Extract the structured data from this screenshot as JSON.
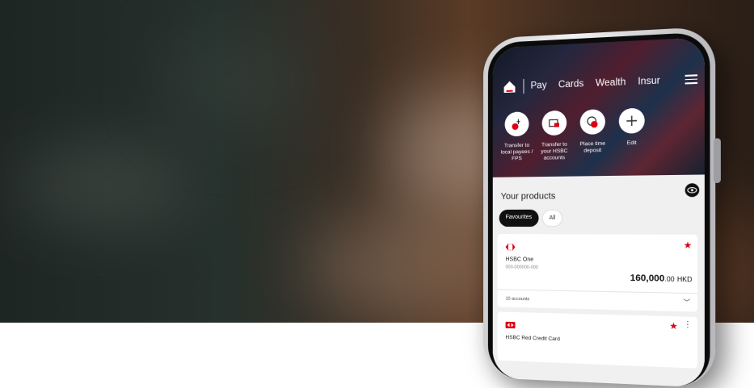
{
  "nav": {
    "items": [
      "Pay",
      "Cards",
      "Wealth",
      "Insur"
    ]
  },
  "actions": [
    {
      "icon": "transfer-local-icon",
      "label": "Transfer to local payees / FPS"
    },
    {
      "icon": "transfer-hsbc-icon",
      "label": "Transfer to your HSBC accounts"
    },
    {
      "icon": "time-deposit-icon",
      "label": "Place time deposit"
    },
    {
      "icon": "plus-icon",
      "label": "Edit"
    }
  ],
  "products": {
    "title": "Your products",
    "tabs": [
      "Favourites",
      "All"
    ],
    "account": {
      "name": "HSBC One",
      "number": "000-000000-000",
      "balance_main": "160,000",
      "balance_decimal": ".00",
      "currency": "HKD",
      "accounts_count": "10 accounts"
    },
    "card": {
      "name": "HSBC Red Credit Card"
    }
  },
  "colors": {
    "brand_red": "#db0011"
  }
}
